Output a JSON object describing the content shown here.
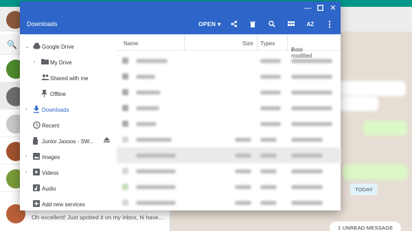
{
  "window": {
    "title": "Downloads"
  },
  "toolbar": {
    "open_label": "OPEN",
    "sort_label": "AZ"
  },
  "sidebar": {
    "google_drive": "Google Drive",
    "my_drive": "My Drive",
    "shared_with_me": "Shared with me",
    "offline": "Offline",
    "downloads": "Downloads",
    "recent": "Recent",
    "usb_device": "Junior Jasoos - SW...",
    "images": "Images",
    "videos": "Videos",
    "audio": "Audio",
    "add_services": "Add new services"
  },
  "columns": {
    "name": "Name",
    "size": "Size",
    "types": "Types",
    "date": "Date modified"
  },
  "background": {
    "search_icon": "🔍",
    "message_preview": "Oh excellent! Just spotted it on my inbox, hi have...",
    "today": "TODAY",
    "unread": "1 UNREAD MESSAGE"
  },
  "colors": {
    "accent": "#2d66c8",
    "chat_header": "#009688",
    "chat_bg": "#e6ddd4"
  }
}
